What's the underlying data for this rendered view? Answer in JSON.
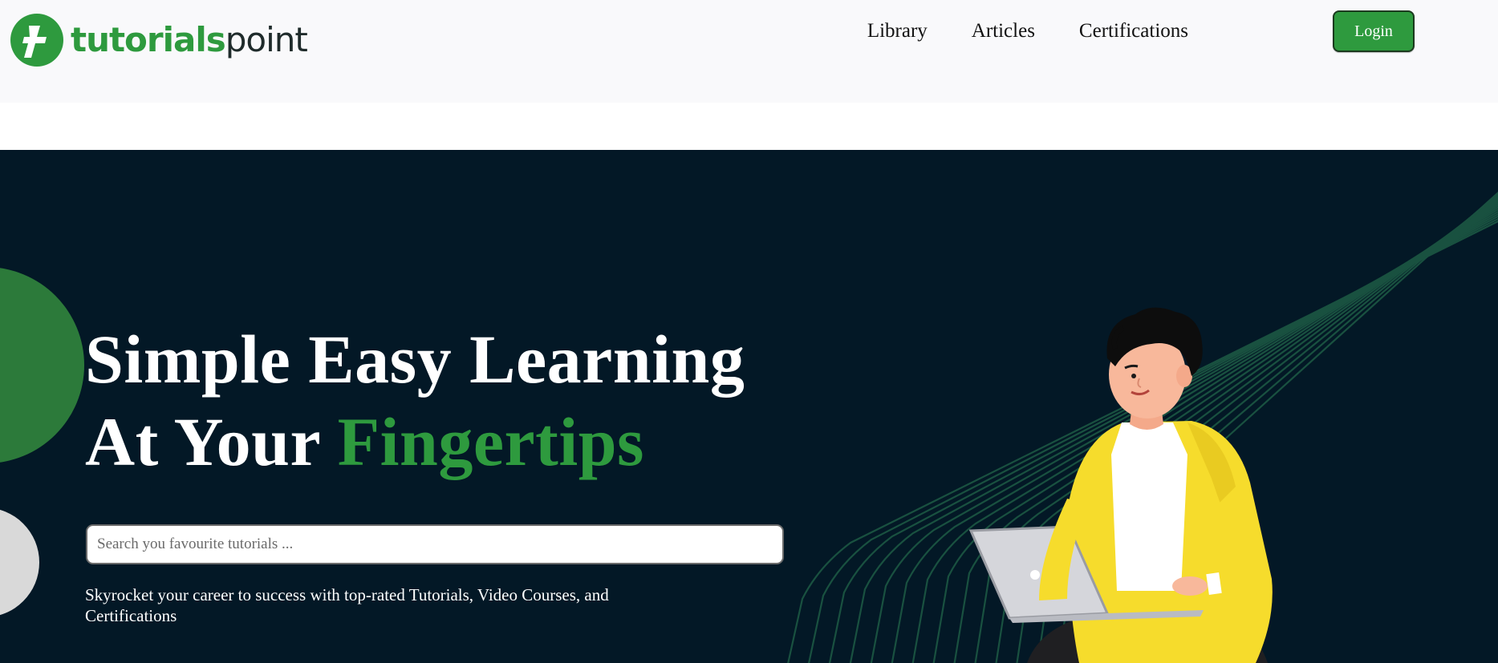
{
  "header": {
    "logo": {
      "part_a": "tutorials",
      "part_b": "point",
      "mark_letter": "t"
    },
    "nav": [
      {
        "label": "Library"
      },
      {
        "label": "Articles"
      },
      {
        "label": "Certifications"
      }
    ],
    "login_label": "Login"
  },
  "hero": {
    "title_line1": "Simple Easy Learning",
    "title_line2_prefix": "At Your ",
    "title_line2_accent": "Fingertips",
    "search_placeholder": "Search you favourite tutorials ...",
    "subtitle": "Skyrocket your career to success with top-rated Tutorials, Video Courses, and Certifications"
  },
  "colors": {
    "brand_green": "#2e9a3e",
    "hero_bg": "#031826",
    "header_bg": "#f9f9fb",
    "line_green": "#1e5c45",
    "shirt_yellow": "#f6dc2c"
  }
}
